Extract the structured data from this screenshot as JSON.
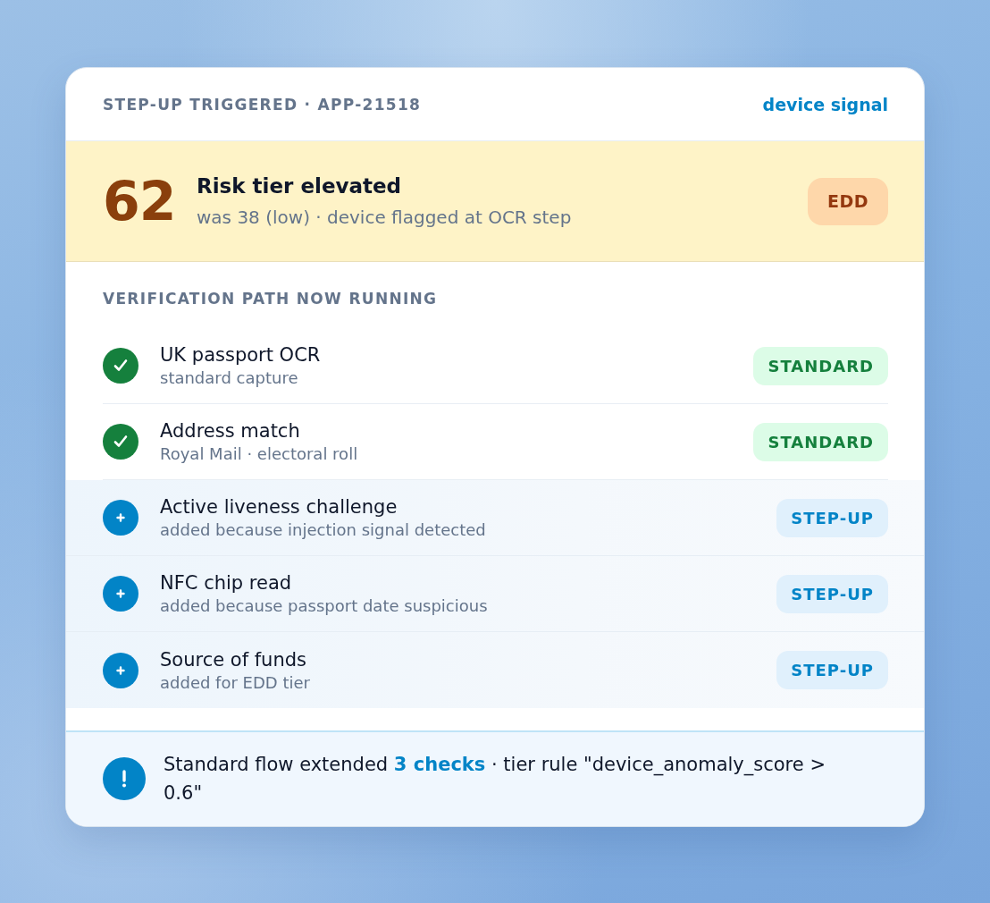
{
  "header": {
    "title": "STEP-UP TRIGGERED · APP-21518",
    "link": "device signal"
  },
  "risk": {
    "score": "62",
    "title": "Risk tier elevated",
    "detail": "was 38 (low) · device flagged at OCR step",
    "badge": "EDD"
  },
  "checks": {
    "heading": "VERIFICATION PATH NOW RUNNING",
    "items": [
      {
        "kind": "standard",
        "title": "UK passport OCR",
        "detail": "standard capture",
        "badge": "STANDARD"
      },
      {
        "kind": "standard",
        "title": "Address match",
        "detail": "Royal Mail · electoral roll",
        "badge": "STANDARD"
      },
      {
        "kind": "step_up",
        "title": "Active liveness challenge",
        "detail": "added because injection signal detected",
        "badge": "STEP-UP"
      },
      {
        "kind": "step_up",
        "title": "NFC chip read",
        "detail": "added because passport date suspicious",
        "badge": "STEP-UP"
      },
      {
        "kind": "step_up",
        "title": "Source of funds",
        "detail": "added for EDD tier",
        "badge": "STEP-UP"
      }
    ]
  },
  "footer": {
    "text": "Standard flow extended **3 checks** · tier rule \"device_anomaly_score > 0.6\""
  }
}
